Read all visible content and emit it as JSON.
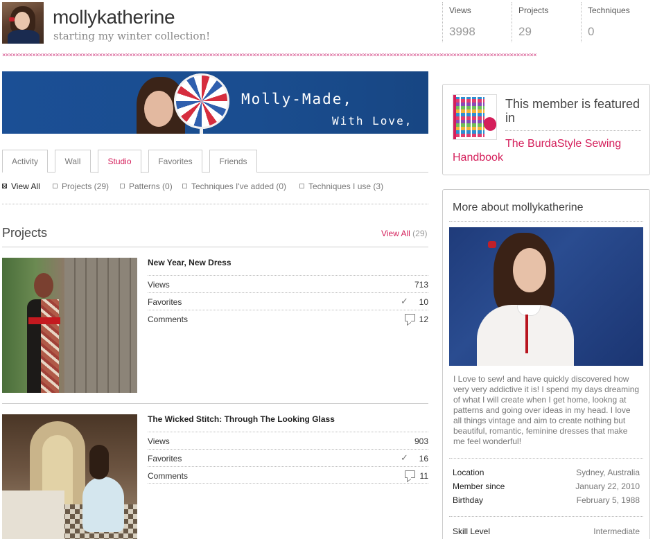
{
  "profile": {
    "username": "mollykatherine",
    "tagline": "starting my winter collection!",
    "stats": [
      {
        "label": "Views",
        "value": "3998"
      },
      {
        "label": "Projects",
        "value": "29"
      },
      {
        "label": "Techniques",
        "value": "0"
      }
    ],
    "stitch_pattern": "××××××××××××××××××××××××××××××××××××××××××××××××××××××××××××××××××××××××××××××××××××××××××××××××××××××××××××××××××××××××××××××××××××××××××××××××××××××××××××××××"
  },
  "banner": {
    "line1": "Molly-Made,",
    "line2": "With Love,"
  },
  "tabs": [
    {
      "label": "Activity",
      "active": false
    },
    {
      "label": "Wall",
      "active": false
    },
    {
      "label": "Studio",
      "active": true
    },
    {
      "label": "Favorites",
      "active": false
    },
    {
      "label": "Friends",
      "active": false
    }
  ],
  "filters": [
    {
      "label": "View All",
      "active": true
    },
    {
      "label": "Projects (29)",
      "active": false
    },
    {
      "label": "Patterns (0)",
      "active": false
    },
    {
      "label": "Techniques I've added (0)",
      "active": false
    },
    {
      "label": "Techniques I use (3)",
      "active": false
    }
  ],
  "projects": {
    "heading": "Projects",
    "view_all_label": "View All",
    "view_all_count": "(29)",
    "items": [
      {
        "title": "New Year, New Dress",
        "views_label": "Views",
        "views": "713",
        "favorites_label": "Favorites",
        "favorites": "10",
        "comments_label": "Comments",
        "comments": "12"
      },
      {
        "title": "The Wicked Stitch: Through The Looking Glass",
        "views_label": "Views",
        "views": "903",
        "favorites_label": "Favorites",
        "favorites": "16",
        "comments_label": "Comments",
        "comments": "11"
      }
    ]
  },
  "sidebar": {
    "featured_text": "This member is featured in",
    "featured_link": "The BurdaStyle Sewing Handbook",
    "about_heading": "More about mollykatherine",
    "bio": "I Love to sew! and have quickly discovered how very very addictive it is! I spend my days dreaming of what I will create when I get home, lookng at patterns and going over ideas in my head. I love all things vintage and aim to create nothing but beautiful, romantic, feminine dresses that make me feel wonderful!",
    "details": [
      {
        "label": "Location",
        "value": "Sydney, Australia"
      },
      {
        "label": "Member since",
        "value": "January 22, 2010"
      },
      {
        "label": "Birthday",
        "value": "February 5, 1988"
      }
    ],
    "skill_label": "Skill Level",
    "skill_value": "Intermediate"
  },
  "colors": {
    "accent": "#d41e5a",
    "banner_blue": "#1b4f95",
    "stitch": "#d44a88"
  }
}
